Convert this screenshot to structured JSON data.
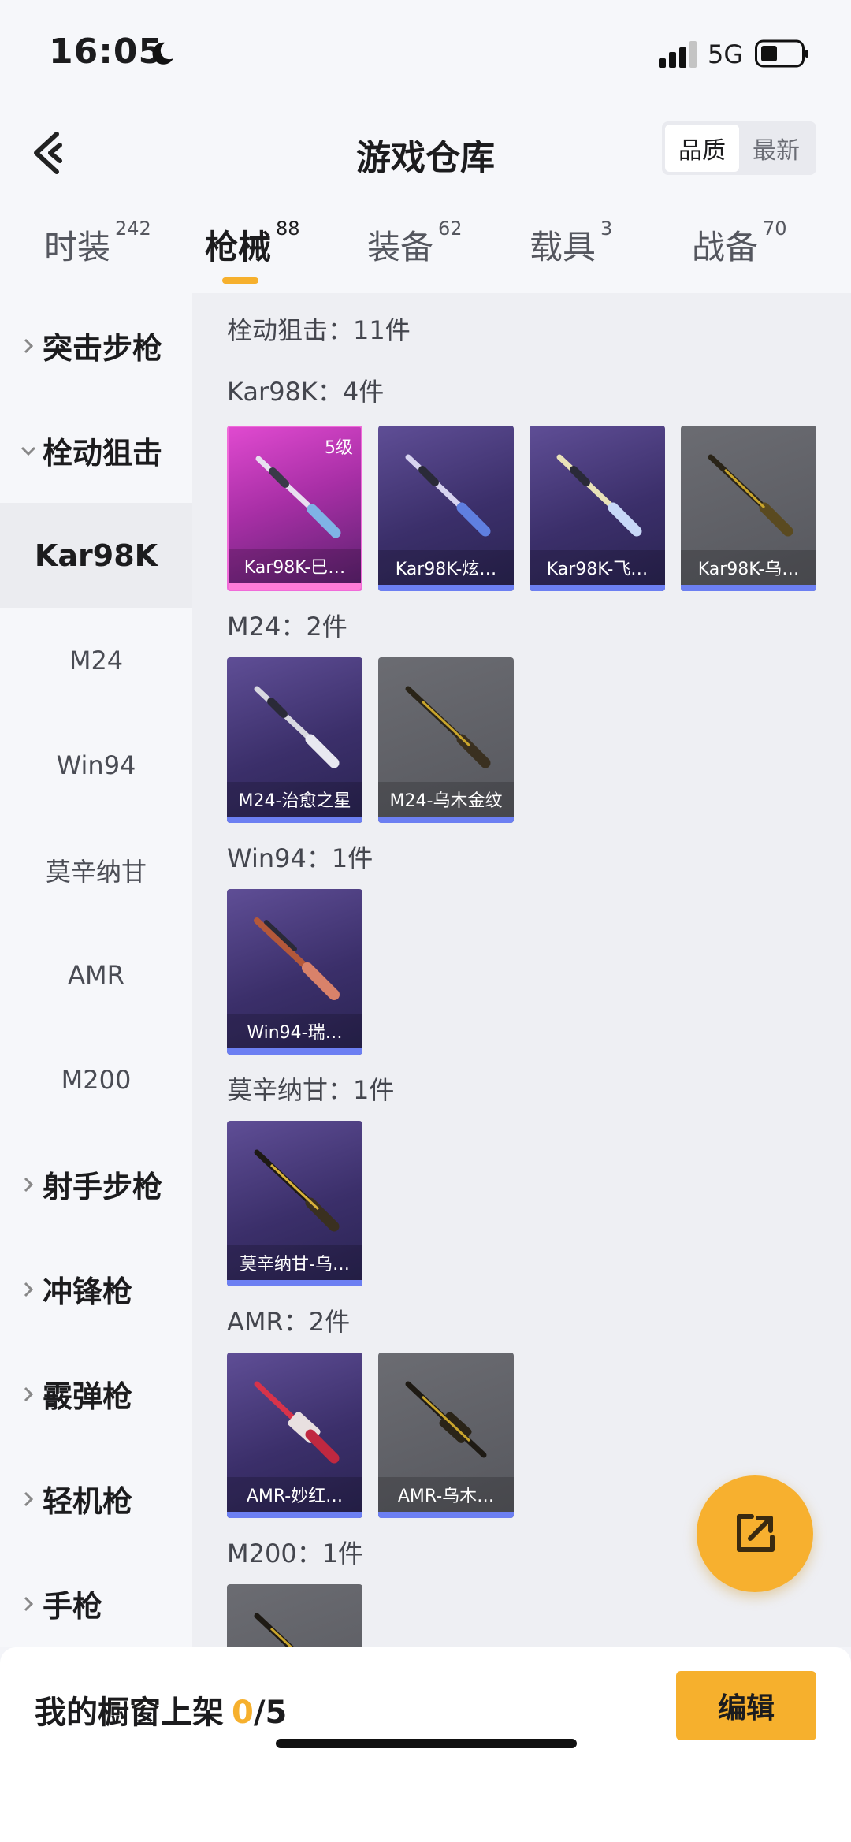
{
  "status": {
    "time": "16:05",
    "network": "5G"
  },
  "header": {
    "title": "游戏仓库",
    "sort": {
      "quality": "品质",
      "newest": "最新"
    }
  },
  "tabs": [
    {
      "label": "时装",
      "count": "242"
    },
    {
      "label": "枪械",
      "count": "88"
    },
    {
      "label": "装备",
      "count": "62"
    },
    {
      "label": "载具",
      "count": "3"
    },
    {
      "label": "战备",
      "count": "70"
    }
  ],
  "sidebar": {
    "groups": [
      "突击步枪",
      "栓动狙击",
      "射手步枪",
      "冲锋枪",
      "霰弹枪",
      "轻机枪",
      "手枪"
    ],
    "subitems": [
      "Kar98K",
      "M24",
      "Win94",
      "莫辛纳甘",
      "AMR",
      "M200"
    ]
  },
  "content": {
    "category_total": "栓动狙击：11件",
    "sections": [
      {
        "heading": "Kar98K：4件",
        "items": [
          {
            "name": "Kar98K-巳…",
            "level": "5级",
            "color": "magenta"
          },
          {
            "name": "Kar98K-炫…",
            "color": "purple"
          },
          {
            "name": "Kar98K-飞…",
            "color": "purple"
          },
          {
            "name": "Kar98K-乌…",
            "color": "grey"
          }
        ]
      },
      {
        "heading": "M24：2件",
        "items": [
          {
            "name": "M24-治愈之星",
            "color": "purple"
          },
          {
            "name": "M24-乌木金纹",
            "color": "grey"
          }
        ]
      },
      {
        "heading": "Win94：1件",
        "items": [
          {
            "name": "Win94-瑞…",
            "color": "purple"
          }
        ]
      },
      {
        "heading": "莫辛纳甘：1件",
        "items": [
          {
            "name": "莫辛纳甘-乌…",
            "color": "purple"
          }
        ]
      },
      {
        "heading": "AMR：2件",
        "items": [
          {
            "name": "AMR-妙红…",
            "color": "purple"
          },
          {
            "name": "AMR-乌木…",
            "color": "grey"
          }
        ]
      },
      {
        "heading": "M200：1件",
        "items": [
          {
            "name": "",
            "color": "grey"
          }
        ]
      }
    ]
  },
  "bottom": {
    "label": "我的橱窗上架",
    "used": "0",
    "total": "/5",
    "edit": "编辑"
  },
  "colors": {
    "accent": "#f6b02d",
    "purple_card": "#3b2f6a",
    "magenta_card": "#a82fa6",
    "grey_card": "#56575d",
    "card_bar": "#6c7ff2"
  }
}
